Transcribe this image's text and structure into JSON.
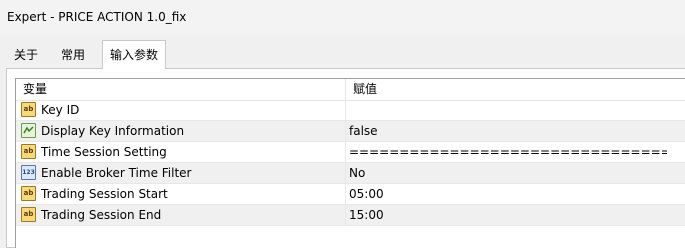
{
  "window": {
    "title": "Expert - PRICE ACTION 1.0_fix"
  },
  "tabs": [
    {
      "label": "关于"
    },
    {
      "label": "常用"
    },
    {
      "label": "输入参数"
    }
  ],
  "table": {
    "columns": {
      "name": "变量",
      "value": "赋值"
    },
    "rows": [
      {
        "icon": "string-type-icon",
        "icon_text": "ab",
        "name": "Key ID",
        "value": ""
      },
      {
        "icon": "bool-type-icon",
        "icon_text": "",
        "name": "Display Key Information",
        "value": "false"
      },
      {
        "icon": "string-type-icon",
        "icon_text": "ab",
        "name": "Time Session Setting",
        "value": "====================================..."
      },
      {
        "icon": "enum-type-icon",
        "icon_text": "123",
        "name": "Enable Broker Time Filter",
        "value": "No"
      },
      {
        "icon": "string-type-icon",
        "icon_text": "ab",
        "name": "Trading Session Start",
        "value": "05:00"
      },
      {
        "icon": "string-type-icon",
        "icon_text": "ab",
        "name": "Trading Session End",
        "value": "15:00"
      }
    ]
  }
}
